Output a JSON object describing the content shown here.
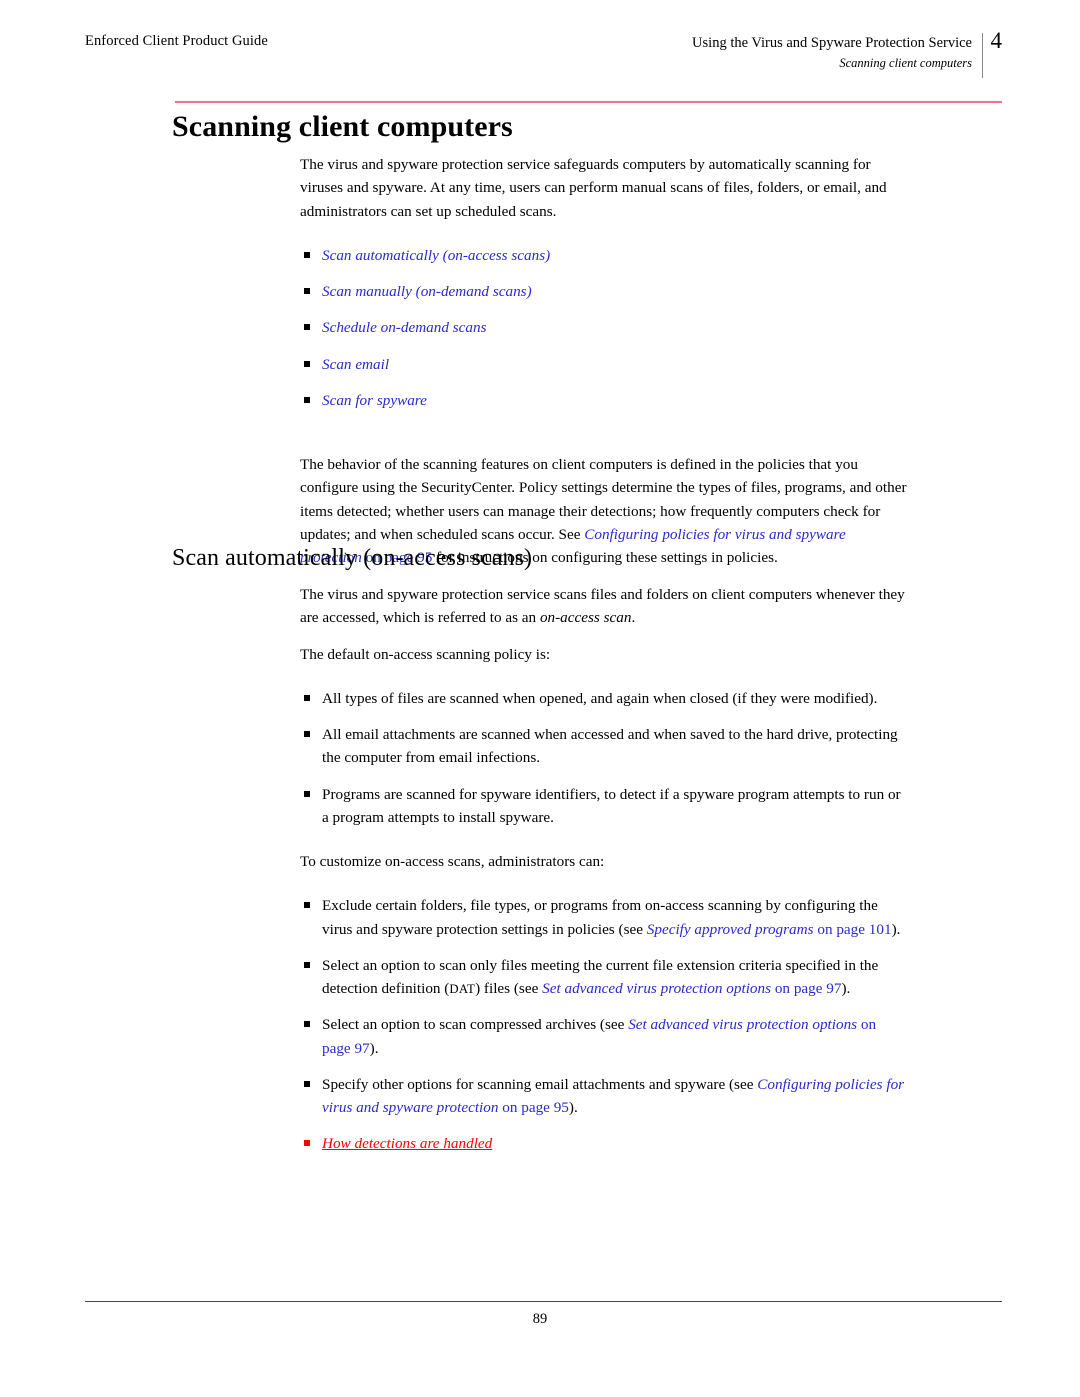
{
  "header": {
    "left_text": "Enforced Client Product Guide",
    "right_title": "Using the Virus and Spyware Protection Service",
    "right_subtitle": "Scanning client computers",
    "chapter_number": "4"
  },
  "title": "Scanning client computers",
  "intro_paragraph": "The virus and spyware protection service safeguards computers by automatically scanning for viruses and spyware. At any time, users can perform manual scans of files, folders, or email, and administrators can set up scheduled scans.",
  "topic_links": [
    "Scan automatically (on-access scans)",
    "Scan manually (on-demand scans)",
    "Schedule on-demand scans",
    "Scan email",
    "Scan for spyware"
  ],
  "behavior_paragraph": {
    "lead": "The behavior of the scanning features on client computers is defined in the policies that you configure using the SecurityCenter. Policy settings determine the types of files, programs, and other items detected; whether users can manage their detections; how frequently computers check for updates; and when scheduled scans occur. See ",
    "link_italic": "Configuring policies for virus and spyware protection",
    "link_page": " on page 95",
    "tail": " for instructions on configuring these settings in policies."
  },
  "section2": {
    "heading": "Scan automatically (on-access scans)",
    "paragraph_1_lead": "The virus and spyware protection service scans files and folders on client computers whenever they are accessed, which is referred to as an ",
    "paragraph_1_italic": "on-access scan",
    "paragraph_1_tail": ".",
    "paragraph_2": "The default on-access scanning policy is:",
    "default_policy_bullets": [
      "All types of files are scanned when opened, and again when closed (if they were modified).",
      "All email attachments are scanned when accessed and when saved to the hard drive, protecting the computer from email infections.",
      "Programs are scanned for spyware identifiers, to detect if a spyware program attempts to run or a program attempts to install spyware."
    ],
    "customize_intro": "To customize on-access scans, administrators can:",
    "customize_bullets": [
      {
        "lead": "Exclude certain folders, file types, or programs from on-access scanning by configuring the virus and spyware protection settings in policies (see ",
        "link_italic": "Specify approved programs",
        "link_page": " on page 101",
        "tail": ")."
      },
      {
        "lead": "Select an option to scan only files meeting the current file extension criteria specified in the detection definition (",
        "smallcaps": "DAT",
        "lead2": ") files (see ",
        "link_italic": "Set advanced virus protection options",
        "link_page": " on page 97",
        "tail": ")."
      },
      {
        "lead": "Select an option to scan compressed archives (see ",
        "link_italic": "Set advanced virus protection options",
        "link_page": " on page 97",
        "tail": ")."
      },
      {
        "lead": "Specify other options for scanning email attachments and spyware (see ",
        "link_italic": "Configuring policies for virus and spyware protection",
        "link_page": " on page 95",
        "tail": ")."
      }
    ],
    "red_link": "How detections are handled"
  },
  "footer": {
    "page_number": "89"
  },
  "colors": {
    "link_blue": "#2a2acc",
    "red_link": "#ff0000",
    "title_rule": "#f2708a",
    "footer_rule": "#4a4a4a"
  }
}
